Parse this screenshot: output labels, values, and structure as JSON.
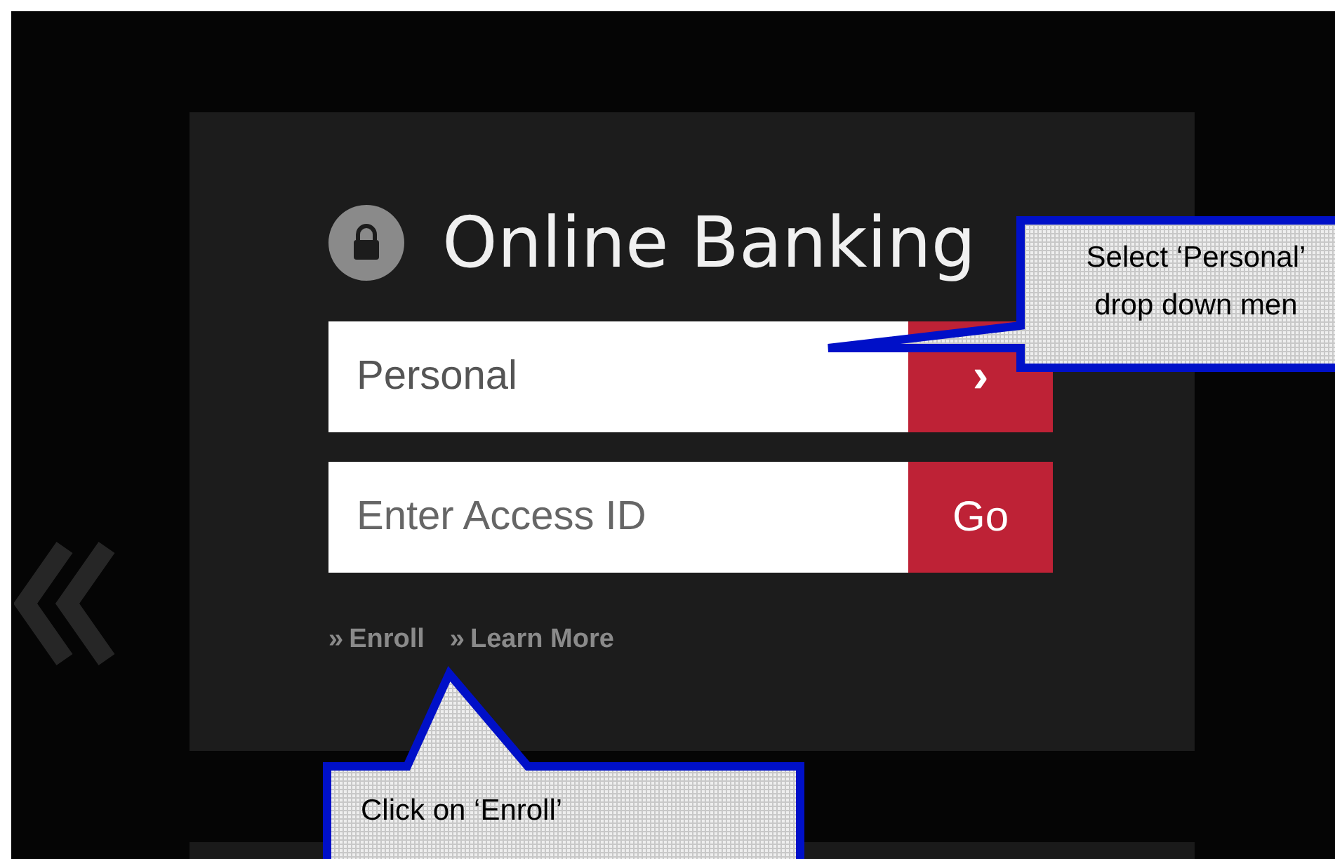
{
  "login": {
    "title": "Online Banking",
    "fields": [
      {
        "kind": "dropdown",
        "value": "Personal",
        "button": "›"
      },
      {
        "kind": "input",
        "placeholder": "Enter Access ID",
        "button": "Go"
      }
    ],
    "links": [
      {
        "icon": "»",
        "label": "Enroll"
      },
      {
        "icon": "»",
        "label": "Learn More"
      }
    ]
  },
  "callouts": [
    {
      "kind": "left",
      "lines": [
        "Select ‘Personal’",
        "drop down men"
      ]
    },
    {
      "kind": "up",
      "lines": [
        "Click on ‘Enroll’"
      ]
    }
  ]
}
